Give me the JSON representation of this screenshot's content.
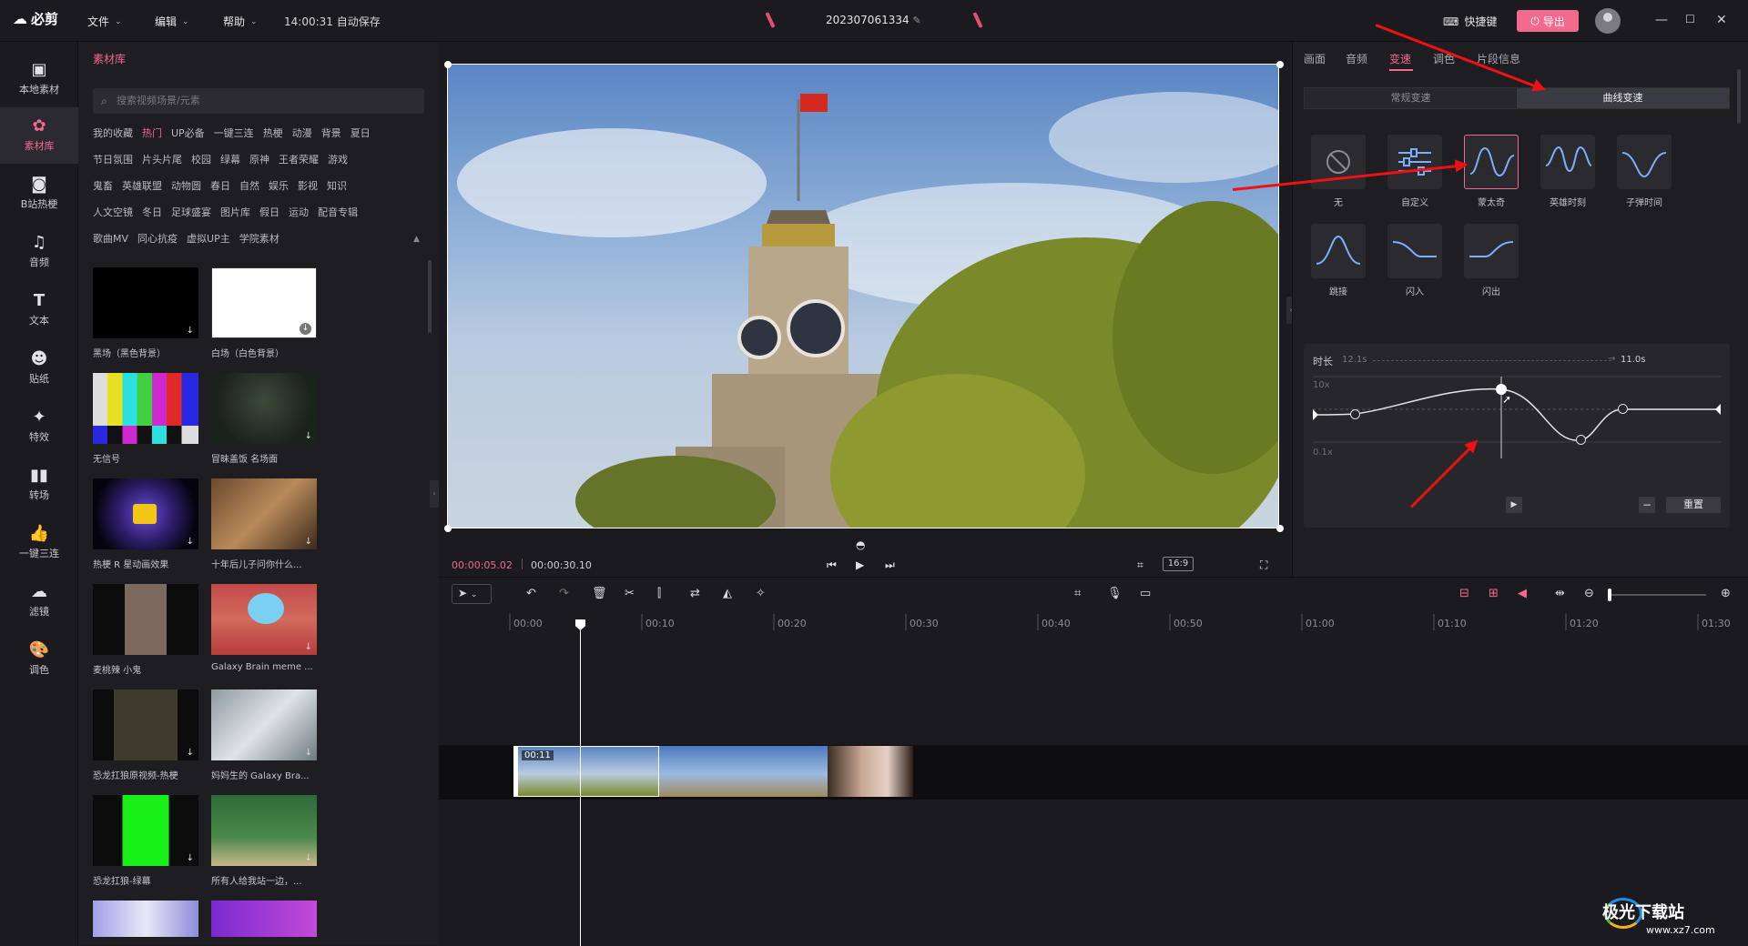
{
  "app": {
    "logo": "必剪",
    "menu": [
      "文件",
      "编辑",
      "帮助"
    ],
    "autosave": "14:00:31 自动保存",
    "project_name": "202307061334",
    "shortcut_label": "快捷键",
    "export_label": "导出"
  },
  "leftnav": [
    {
      "label": "本地素材",
      "icon": "folder-icon"
    },
    {
      "label": "素材库",
      "icon": "library-icon"
    },
    {
      "label": "B站热梗",
      "icon": "bilibili-icon"
    },
    {
      "label": "音频",
      "icon": "music-icon"
    },
    {
      "label": "文本",
      "icon": "text-icon"
    },
    {
      "label": "贴纸",
      "icon": "sticker-icon"
    },
    {
      "label": "特效",
      "icon": "star-icon"
    },
    {
      "label": "转场",
      "icon": "transition-icon"
    },
    {
      "label": "一键三连",
      "icon": "thumb-icon"
    },
    {
      "label": "滤镜",
      "icon": "filter-icon"
    },
    {
      "label": "调色",
      "icon": "palette-icon"
    }
  ],
  "library": {
    "tab": "素材库",
    "search_placeholder": "搜索视频场景/元素",
    "tag_rows": [
      [
        "我的收藏",
        "热门",
        "UP必备",
        "一键三连",
        "热梗",
        "动漫",
        "背景",
        "夏日"
      ],
      [
        "节日氛围",
        "片头片尾",
        "校园",
        "绿幕",
        "原神",
        "王者荣耀",
        "游戏"
      ],
      [
        "鬼畜",
        "英雄联盟",
        "动物圆",
        "春日",
        "自然",
        "娱乐",
        "影视",
        "知识"
      ],
      [
        "人文空镜",
        "冬日",
        "足球盛宴",
        "图片库",
        "假日",
        "运动",
        "配音专辑"
      ],
      [
        "歌曲MV",
        "同心抗疫",
        "虚拟UP主",
        "学院素材"
      ]
    ],
    "items": [
      {
        "caption": "黑场（黑色背景）"
      },
      {
        "caption": "白场（白色背景）"
      },
      {
        "caption": "无信号"
      },
      {
        "caption": "冒昧盖饭 名场面"
      },
      {
        "caption": "热梗 R 星动画效果"
      },
      {
        "caption": "十年后儿子问你什么..."
      },
      {
        "caption": "麦桃辣 小鬼"
      },
      {
        "caption": "Galaxy Brain meme ..."
      },
      {
        "caption": "恐龙扛狼原视频-热梗"
      },
      {
        "caption": "妈妈生的 Galaxy Bra..."
      },
      {
        "caption": "恐龙扛狼-绿幕"
      },
      {
        "caption": "所有人给我站一边，..."
      },
      {
        "caption": ""
      },
      {
        "caption": ""
      }
    ]
  },
  "player": {
    "current_time": "00:00:05.02",
    "total_time": "00:00:30.10",
    "ratio": "16:9"
  },
  "props": {
    "tabs": [
      "画面",
      "音频",
      "变速",
      "调色",
      "片段信息"
    ],
    "active_tab": "变速",
    "speed_modes": [
      "常规变速",
      "曲线变速"
    ],
    "presets": [
      {
        "label": "无",
        "icon": "none-icon"
      },
      {
        "label": "自定义",
        "icon": "custom-sliders-icon"
      },
      {
        "label": "蒙太奇",
        "icon": "montage-curve-icon"
      },
      {
        "label": "英雄时刻",
        "icon": "hero-curve-icon"
      },
      {
        "label": "子弹时间",
        "icon": "bullet-curve-icon"
      },
      {
        "label": "跳接",
        "icon": "jump-curve-icon"
      },
      {
        "label": "闪入",
        "icon": "flash-in-curve-icon"
      },
      {
        "label": "闪出",
        "icon": "flash-out-curve-icon"
      }
    ],
    "duration_label": "时长",
    "duration_from": "12.1s",
    "duration_to": "11.0s",
    "axis_top": "10x",
    "axis_bottom": "0.1x",
    "reset_label": "重置"
  },
  "timeline": {
    "ticks": [
      "00:00",
      "00:10",
      "00:20",
      "00:30",
      "00:40",
      "00:50",
      "01:00",
      "01:10",
      "01:20",
      "01:30"
    ],
    "clip_label": "00:11"
  },
  "watermark": {
    "name": "极光下载站",
    "url": "www.xz7.com"
  },
  "colors": {
    "accent": "#f26a8d",
    "annotation_arrow": "#e11111"
  }
}
